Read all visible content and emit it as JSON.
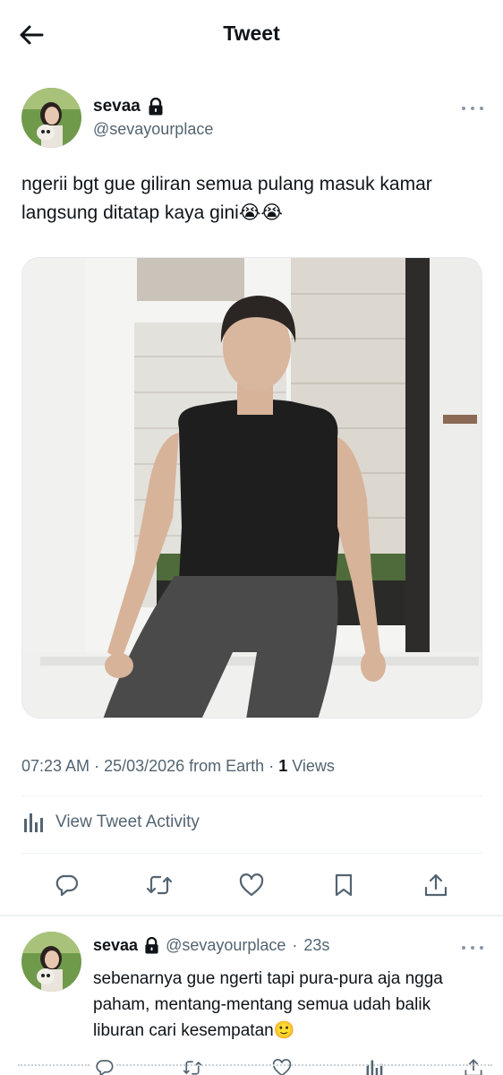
{
  "header": {
    "title": "Tweet"
  },
  "tweet": {
    "author_name": "sevaa",
    "author_handle": "@sevayourplace",
    "text": "ngerii bgt gue giliran semua pulang masuk kamar langsung ditatap kaya gini😭😭",
    "time": "07:23 AM",
    "sep1": " · ",
    "date": "25/03/2026",
    "source": " from Earth",
    "sep2": " · ",
    "views_count": "1",
    "views_label": " Views",
    "activity_label": "View Tweet Activity"
  },
  "reply": {
    "author_name": "sevaa",
    "author_handle": "@sevayourplace",
    "dot": "·",
    "time": "23s",
    "text": "sebenarnya gue ngerti tapi pura-pura aja ngga paham, mentang-mentang semua udah balik liburan cari kesempatan🙂"
  },
  "icons": [
    "back-arrow-icon",
    "lock-icon",
    "more-icon",
    "analytics-icon",
    "reply-icon",
    "retweet-icon",
    "like-icon",
    "bookmark-icon",
    "share-icon"
  ],
  "colors": {
    "text": "#0f1419",
    "secondary": "#536471",
    "divider": "#eff3f4"
  }
}
